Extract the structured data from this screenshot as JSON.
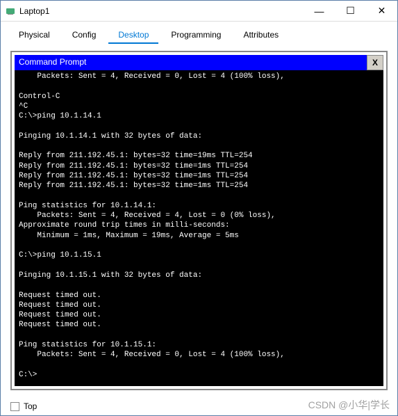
{
  "window": {
    "title": "Laptop1",
    "controls": {
      "min": "—",
      "max": "☐",
      "close": "✕"
    }
  },
  "tabs": {
    "items": [
      {
        "label": "Physical"
      },
      {
        "label": "Config"
      },
      {
        "label": "Desktop"
      },
      {
        "label": "Programming"
      },
      {
        "label": "Attributes"
      }
    ],
    "activeIndex": 2
  },
  "cmd": {
    "title": "Command Prompt",
    "closeLabel": "X"
  },
  "terminal": {
    "lines": [
      "    Packets: Sent = 4, Received = 0, Lost = 4 (100% loss),",
      "",
      "Control-C",
      "^C",
      "C:\\>ping 10.1.14.1",
      "",
      "Pinging 10.1.14.1 with 32 bytes of data:",
      "",
      "Reply from 211.192.45.1: bytes=32 time=19ms TTL=254",
      "Reply from 211.192.45.1: bytes=32 time=1ms TTL=254",
      "Reply from 211.192.45.1: bytes=32 time=1ms TTL=254",
      "Reply from 211.192.45.1: bytes=32 time=1ms TTL=254",
      "",
      "Ping statistics for 10.1.14.1:",
      "    Packets: Sent = 4, Received = 4, Lost = 0 (0% loss),",
      "Approximate round trip times in milli-seconds:",
      "    Minimum = 1ms, Maximum = 19ms, Average = 5ms",
      "",
      "C:\\>ping 10.1.15.1",
      "",
      "Pinging 10.1.15.1 with 32 bytes of data:",
      "",
      "Request timed out.",
      "Request timed out.",
      "Request timed out.",
      "Request timed out.",
      "",
      "Ping statistics for 10.1.15.1:",
      "    Packets: Sent = 4, Received = 0, Lost = 4 (100% loss),",
      "",
      "C:\\>"
    ]
  },
  "bottom": {
    "topLabel": "Top",
    "topChecked": false
  },
  "watermark": "CSDN @小华|学长"
}
